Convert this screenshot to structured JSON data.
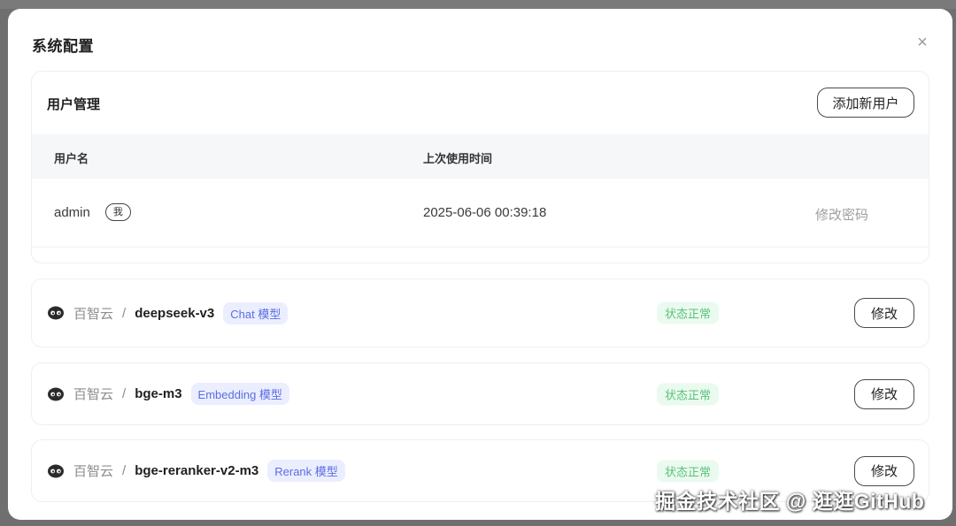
{
  "modal": {
    "title": "系统配置",
    "close_symbol": "×"
  },
  "user_management": {
    "title": "用户管理",
    "add_user_label": "添加新用户",
    "columns": [
      "用户名",
      "上次使用时间"
    ],
    "rows": [
      {
        "username": "admin",
        "badge": "我",
        "last_used": "2025-06-06 00:39:18",
        "action": "修改密码"
      }
    ]
  },
  "models": [
    {
      "provider": "百智云",
      "separator": "/",
      "name": "deepseek-v3",
      "type_tag": "Chat 模型",
      "status": "状态正常",
      "edit_label": "修改",
      "icon": "provider-logo-icon"
    },
    {
      "provider": "百智云",
      "separator": "/",
      "name": "bge-m3",
      "type_tag": "Embedding 模型",
      "status": "状态正常",
      "edit_label": "修改",
      "icon": "provider-logo-icon"
    },
    {
      "provider": "百智云",
      "separator": "/",
      "name": "bge-reranker-v2-m3",
      "type_tag": "Rerank 模型",
      "status": "状态正常",
      "edit_label": "修改",
      "icon": "provider-logo-icon"
    }
  ],
  "watermark": "掘金技术社区 @ 逛逛GitHub",
  "colors": {
    "tag_bg": "#ebeeff",
    "tag_text": "#5b6ee1",
    "status_bg": "#eafaef",
    "status_text": "#59c27a"
  }
}
